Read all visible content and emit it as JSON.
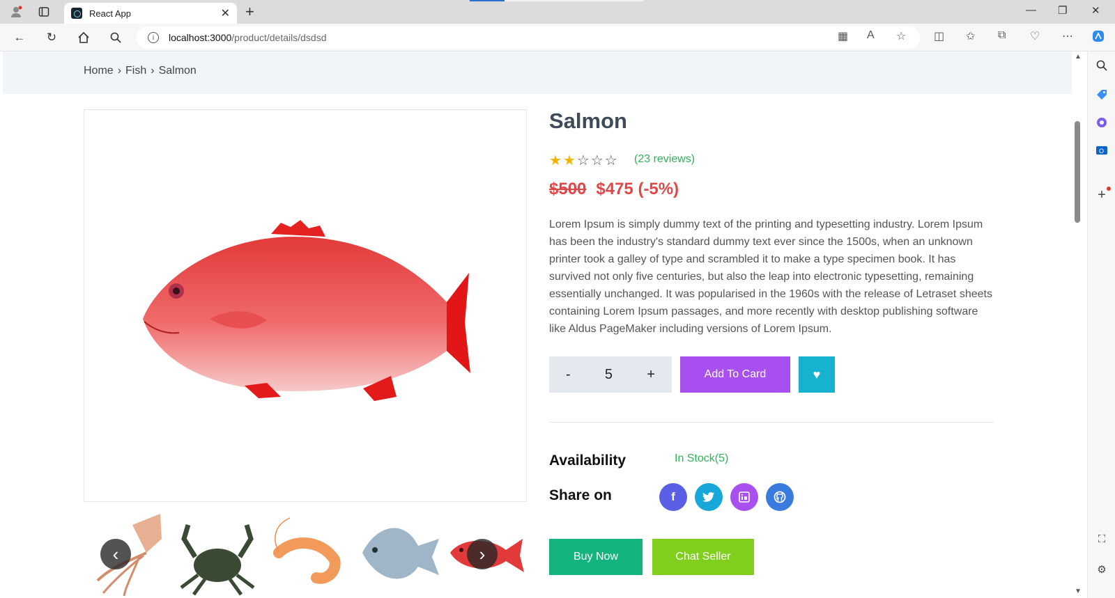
{
  "browser": {
    "tab_title": "React App",
    "url_host": "localhost:3000",
    "url_path": "/product/details/dsdsd"
  },
  "breadcrumb": [
    "Home",
    "Fish",
    "Salmon"
  ],
  "breadcrumb_separator": "›",
  "product": {
    "name": "Salmon",
    "rating": 2,
    "rating_max": 5,
    "reviews_label": "(23 reviews)",
    "old_price": "$500",
    "new_price": "$475 (-5%)",
    "description": "Lorem Ipsum is simply dummy text of the printing and typesetting industry. Lorem Ipsum has been the industry's standard dummy text ever since the 1500s, when an unknown printer took a galley of type and scrambled it to make a type specimen book. It has survived not only five centuries, but also the leap into electronic typesetting, remaining essentially unchanged. It was popularised in the 1960s with the release of Letraset sheets containing Lorem Ipsum passages, and more recently with desktop publishing software like Aldus PageMaker including versions of Lorem Ipsum."
  },
  "quantity": {
    "minus": "-",
    "value": "5",
    "plus": "+"
  },
  "buttons": {
    "add_to_cart": "Add To Card",
    "buy_now": "Buy Now",
    "chat_seller": "Chat Seller"
  },
  "availability": {
    "label": "Availability",
    "value": "In Stock(5)"
  },
  "share": {
    "label": "Share on",
    "networks": [
      "facebook-icon",
      "twitter-icon",
      "linkedin-icon",
      "github-icon"
    ]
  },
  "colors": {
    "add_to_cart": "#a84ff0",
    "wishlist": "#16b2d0",
    "buy_now": "#14b47e",
    "chat_seller": "#7fcf1c",
    "price": "#e04848",
    "stock": "#33b05a",
    "facebook": "#5b5fe6",
    "twitter": "#17a7d8",
    "linkedin": "#a84ff0",
    "github": "#3a7be0"
  },
  "thumbnails": [
    "squid",
    "crab",
    "shrimp",
    "pomfret",
    "red snapper"
  ]
}
